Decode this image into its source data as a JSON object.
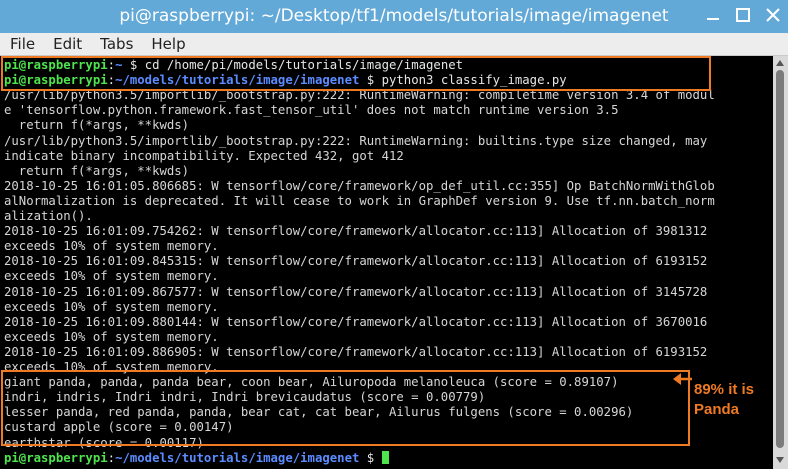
{
  "window": {
    "title": "pi@raspberrypi: ~/Desktop/tf1/models/tutorials/image/imagenet"
  },
  "menu": [
    "File",
    "Edit",
    "Tabs",
    "Help"
  ],
  "terminal": {
    "cmd1": {
      "user": "pi@raspberrypi",
      "sep": ":",
      "path": "~",
      "prompt": " $ ",
      "command": "cd /home/pi/models/tutorials/image/imagenet"
    },
    "cmd2": {
      "user": "pi@raspberrypi",
      "sep": ":",
      "path": "~/models/tutorials/image/imagenet",
      "prompt": " $ ",
      "command": "python3 classify_image.py"
    },
    "output": [
      "/usr/lib/python3.5/importlib/_bootstrap.py:222: RuntimeWarning: compiletime version 3.4 of modul",
      "e 'tensorflow.python.framework.fast_tensor_util' does not match runtime version 3.5",
      "  return f(*args, **kwds)",
      "/usr/lib/python3.5/importlib/_bootstrap.py:222: RuntimeWarning: builtins.type size changed, may",
      "indicate binary incompatibility. Expected 432, got 412",
      "  return f(*args, **kwds)",
      "2018-10-25 16:01:05.806685: W tensorflow/core/framework/op_def_util.cc:355] Op BatchNormWithGlob",
      "alNormalization is deprecated. It will cease to work in GraphDef version 9. Use tf.nn.batch_norm",
      "alization().",
      "2018-10-25 16:01:09.754262: W tensorflow/core/framework/allocator.cc:113] Allocation of 3981312",
      "exceeds 10% of system memory.",
      "2018-10-25 16:01:09.845315: W tensorflow/core/framework/allocator.cc:113] Allocation of 6193152",
      "exceeds 10% of system memory.",
      "2018-10-25 16:01:09.867577: W tensorflow/core/framework/allocator.cc:113] Allocation of 3145728",
      "exceeds 10% of system memory.",
      "2018-10-25 16:01:09.880144: W tensorflow/core/framework/allocator.cc:113] Allocation of 3670016",
      "exceeds 10% of system memory.",
      "2018-10-25 16:01:09.886905: W tensorflow/core/framework/allocator.cc:113] Allocation of 6193152",
      "exceeds 10% of system memory."
    ],
    "predictions": [
      "giant panda, panda, panda bear, coon bear, Ailuropoda melanoleuca (score = 0.89107)",
      "indri, indris, Indri indri, Indri brevicaudatus (score = 0.00779)",
      "lesser panda, red panda, panda, bear cat, cat bear, Ailurus fulgens (score = 0.00296)",
      "custard apple (score = 0.00147)",
      "earthstar (score = 0.00117)"
    ],
    "final_prompt": {
      "user": "pi@raspberrypi",
      "sep": ":",
      "path": "~/models/tutorials/image/imagenet",
      "prompt": " $ "
    }
  },
  "annotation": {
    "line1": "89% it is",
    "line2": "Panda"
  },
  "colors": {
    "titlebar": "#62a9d8",
    "prompt_user": "#4ee44e",
    "prompt_path": "#5b8cff",
    "highlight": "#ef7a24"
  },
  "icons": [
    "minimize-icon",
    "maximize-icon",
    "close-icon",
    "arrow-left-icon"
  ]
}
